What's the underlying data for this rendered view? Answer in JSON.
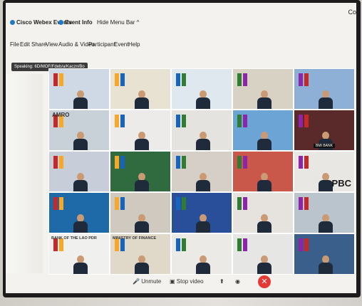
{
  "window": {
    "title": "Cisco Webex Events",
    "tab_event_info": "Event Info",
    "hide_menu": "Hide Menu Bar ^",
    "cutoff_text": "Co"
  },
  "menu": {
    "items": [
      "File",
      "Edit",
      "Share",
      "View",
      "Audio & Video",
      "Participant",
      "Event",
      "Help"
    ]
  },
  "speaking": {
    "label": "Speaking: 6D/MOF/Fdeb/a/Kaczn/Bo"
  },
  "tiles": [
    {
      "caption": ""
    },
    {
      "caption": ""
    },
    {
      "caption": ""
    },
    {
      "caption": ""
    },
    {
      "caption": ""
    },
    {
      "caption": "AMRO"
    },
    {
      "caption": ""
    },
    {
      "caption": ""
    },
    {
      "caption": ""
    },
    {
      "caption": "BMI BANK"
    },
    {
      "caption": ""
    },
    {
      "caption": ""
    },
    {
      "caption": ""
    },
    {
      "caption": ""
    },
    {
      "caption": "PBC"
    },
    {
      "caption": ""
    },
    {
      "caption": ""
    },
    {
      "caption": ""
    },
    {
      "caption": ""
    },
    {
      "caption": ""
    },
    {
      "caption": "BANK OF THE LAO PDR"
    },
    {
      "caption": "MINISTRY OF FINANCE"
    },
    {
      "caption": ""
    },
    {
      "caption": ""
    },
    {
      "caption": ""
    }
  ],
  "controls": {
    "unmute": "Unmute",
    "stop_video": "Stop video",
    "end_icon": "✕"
  },
  "colors": {
    "end_call": "#e53935",
    "accent": "#1f7ac2"
  }
}
